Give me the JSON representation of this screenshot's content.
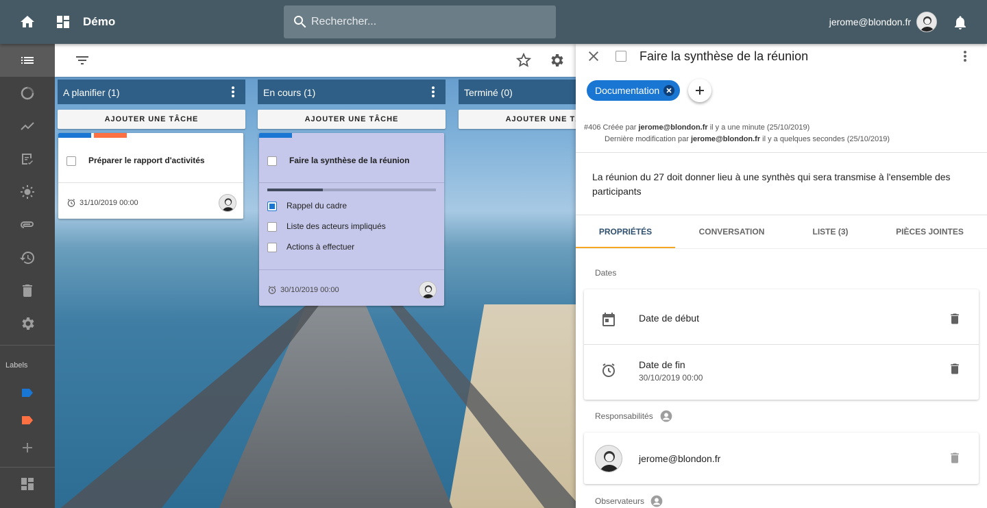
{
  "topbar": {
    "title": "Démo",
    "search_placeholder": "Rechercher...",
    "user": "jerome@blondon.fr"
  },
  "sidebar": {
    "labels_title": "Labels",
    "label_colors": [
      "#1976d2",
      "#ff7043"
    ]
  },
  "board": {
    "columns": [
      {
        "title": "A planifier (1)",
        "add_label": "AJOUTER UNE TÂCHE"
      },
      {
        "title": "En cours (1)",
        "add_label": "AJOUTER UNE TÂCHE"
      },
      {
        "title": "Terminé (0)",
        "add_label": "AJOUTER UNE TÂCHE"
      }
    ],
    "cards": [
      {
        "title": "Préparer le rapport d'activités",
        "date": "31/10/2019 00:00"
      },
      {
        "title": "Faire la synthèse de la réunion",
        "date": "30/10/2019 00:00",
        "progress": 0.33,
        "checklist": [
          "Rappel du cadre",
          "Liste des acteurs impliqués",
          "Actions à effectuer"
        ]
      }
    ]
  },
  "panel": {
    "title": "Faire la synthèse de la réunion",
    "chip": "Documentation",
    "meta_line1_prefix": "#406  Créée par ",
    "meta_line1_user": "jerome@blondon.fr",
    "meta_line1_suffix": " il y a une minute (25/10/2019)",
    "meta_line2_prefix": "Dernière modification par ",
    "meta_line2_user": "jerome@blondon.fr",
    "meta_line2_suffix": " il y a quelques secondes (25/10/2019)",
    "description": "La réunion du 27 doit donner lieu à une synthès qui sera transmise à l'ensemble des participants",
    "tabs": [
      "PROPRIÉTÉS",
      "CONVERSATION",
      "LISTE (3)",
      "PIÈCES JOINTES"
    ],
    "dates_label": "Dates",
    "start_label": "Date de début",
    "end_label": "Date de fin",
    "end_value": "30/10/2019 00:00",
    "resp_label": "Responsabilités",
    "resp_user": "jerome@blondon.fr",
    "observers_label": "Observateurs"
  }
}
